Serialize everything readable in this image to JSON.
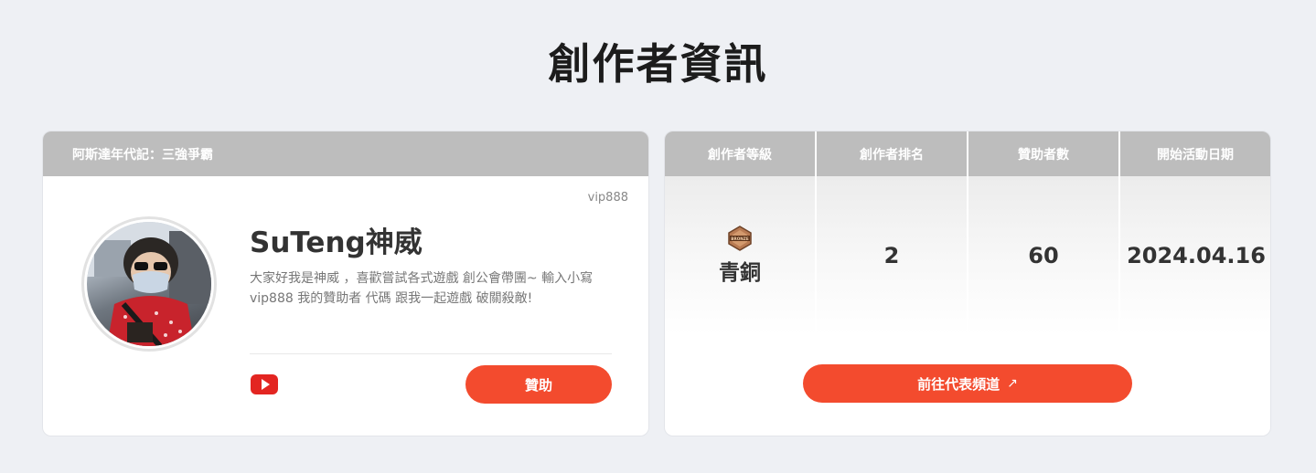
{
  "page": {
    "title": "創作者資訊"
  },
  "profile": {
    "game_title": "阿斯達年代記：三強爭霸",
    "user_id": "vip888",
    "name": "SuTeng神威",
    "bio": "大家好我是神威 ，喜歡嘗試各式遊戲 創公會帶團~ 輸入小寫 vip888 我的贊助者 代碼 跟我一起遊戲 破關殺敵!",
    "youtube_icon": "youtube-icon",
    "sponsor_label": "贊助"
  },
  "stats": {
    "headers": [
      "創作者等級",
      "創作者排名",
      "贊助者數",
      "開始活動日期"
    ],
    "level_badge_text": "BRONZE",
    "level": "青銅",
    "rank": "2",
    "sponsor_count": "60",
    "start_date": "2024.04.16",
    "channel_label": "前往代表頻道",
    "channel_arrow": "↗"
  },
  "colors": {
    "accent": "#f34b2e",
    "header_gray": "#bdbdbd",
    "background": "#eef0f4",
    "youtube_red": "#e32521",
    "bronze": "#b87a52"
  }
}
